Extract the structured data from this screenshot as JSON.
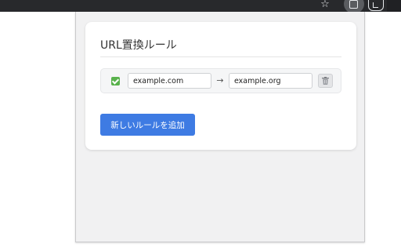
{
  "browser": {
    "bookmark_icon": "star-icon",
    "extension_icon": "extension-active-icon",
    "extensions_menu_icon": "puzzle-icon"
  },
  "popup": {
    "title": "URL置換ルール",
    "rules": [
      {
        "enabled": true,
        "from": "example.com",
        "to": "example.org",
        "arrow": "→",
        "delete_icon": "trash-icon"
      }
    ],
    "add_button_label": "新しいルールを追加"
  },
  "colors": {
    "accent": "#3e7be3",
    "check": "#59b24c",
    "toolbar": "#28292c"
  }
}
